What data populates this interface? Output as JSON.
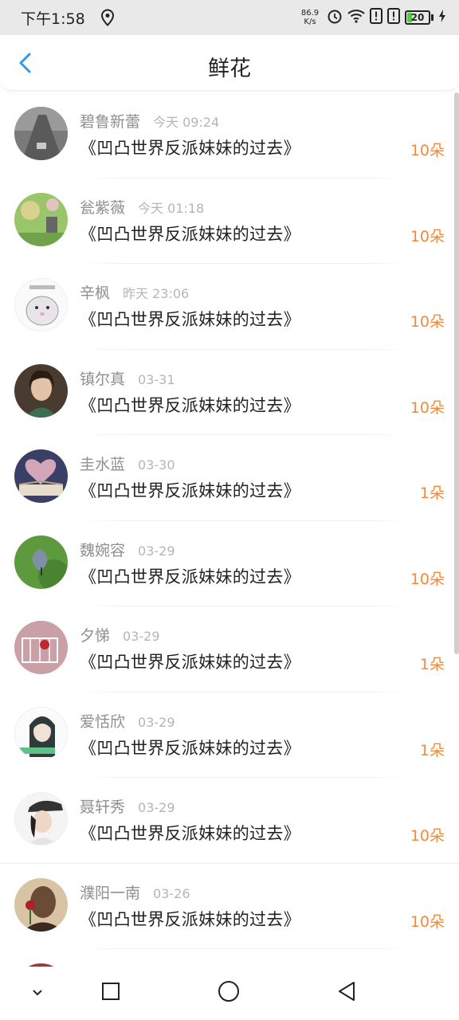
{
  "status_bar": {
    "time": "下午1:58",
    "net_speed_value": "86.9",
    "net_speed_unit": "K/s",
    "battery": "20",
    "battery_level": 0.2
  },
  "header": {
    "title": "鲜花"
  },
  "list": [
    {
      "name": "碧鲁新蕾",
      "time": "今天 09:24",
      "book": "《凹凸世界反派妹妹的过去》",
      "count": "10朵"
    },
    {
      "name": "瓮紫薇",
      "time": "今天 01:18",
      "book": "《凹凸世界反派妹妹的过去》",
      "count": "10朵"
    },
    {
      "name": "辛枫",
      "time": "昨天 23:06",
      "book": "《凹凸世界反派妹妹的过去》",
      "count": "10朵"
    },
    {
      "name": "镇尔真",
      "time": "03-31",
      "book": "《凹凸世界反派妹妹的过去》",
      "count": "10朵"
    },
    {
      "name": "圭水蓝",
      "time": "03-30",
      "book": "《凹凸世界反派妹妹的过去》",
      "count": "1朵"
    },
    {
      "name": "魏婉容",
      "time": "03-29",
      "book": "《凹凸世界反派妹妹的过去》",
      "count": "10朵"
    },
    {
      "name": "夕悌",
      "time": "03-29",
      "book": "《凹凸世界反派妹妹的过去》",
      "count": "1朵"
    },
    {
      "name": "爱恬欣",
      "time": "03-29",
      "book": "《凹凸世界反派妹妹的过去》",
      "count": "1朵"
    },
    {
      "name": "聂轩秀",
      "time": "03-29",
      "book": "《凹凸世界反派妹妹的过去》",
      "count": "10朵"
    },
    {
      "name": "濮阳一南",
      "time": "03-26",
      "book": "《凹凸世界反派妹妹的过去》",
      "count": "10朵"
    }
  ],
  "colors": {
    "accent_blue": "#2f9ae8",
    "count_orange": "#f28a3c"
  },
  "icons": {
    "back": "chevron-left-icon",
    "location": "location-pin-icon",
    "alarm": "alarm-icon",
    "wifi": "wifi-icon",
    "sim_alert": "sim-alert-icon",
    "charging": "charging-bolt-icon",
    "nav_down": "chevron-down-icon",
    "nav_recent": "square-icon",
    "nav_home": "circle-icon",
    "nav_back": "triangle-back-icon"
  }
}
